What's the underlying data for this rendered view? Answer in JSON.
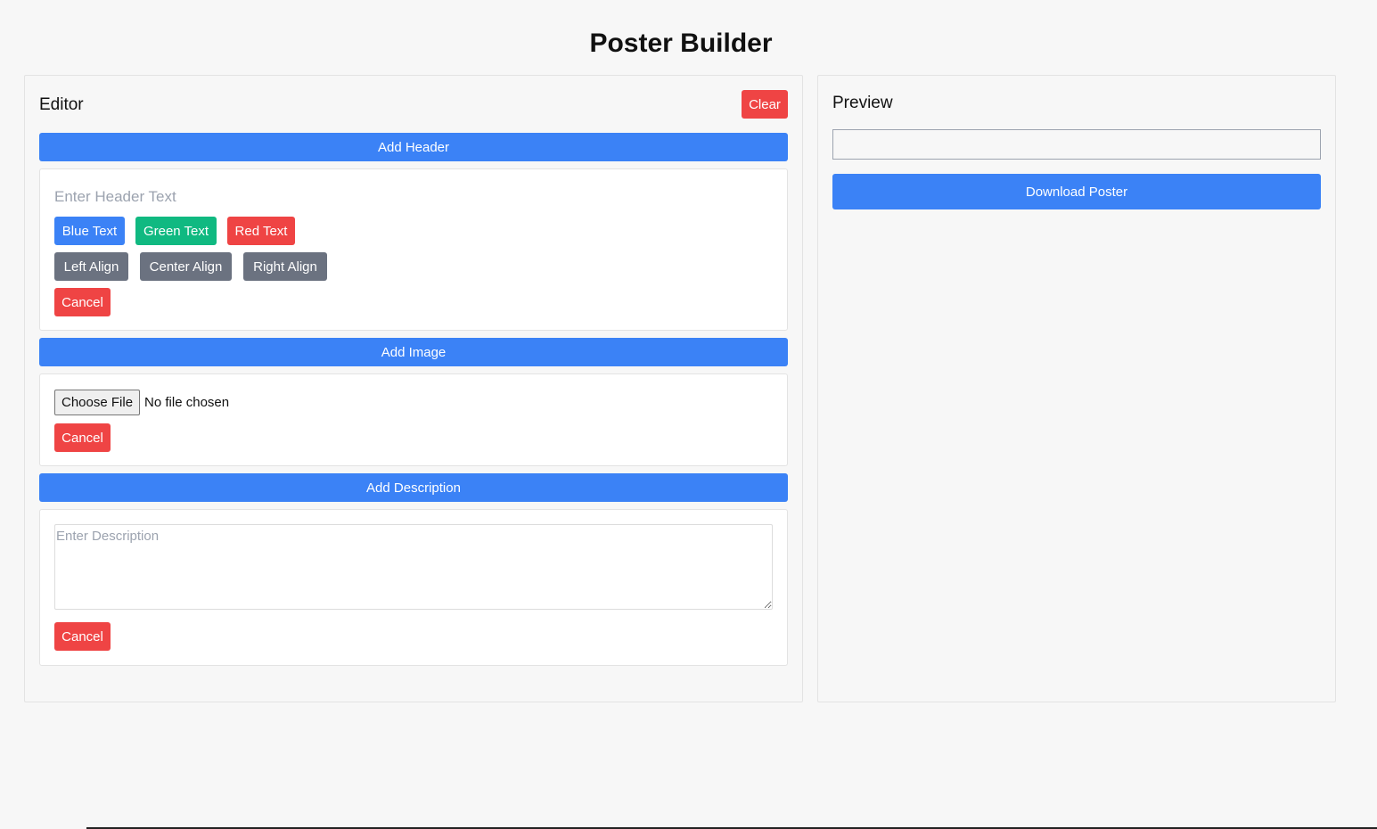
{
  "page": {
    "title": "Poster Builder"
  },
  "editor": {
    "title": "Editor",
    "clear_label": "Clear",
    "header_section": {
      "add_label": "Add Header",
      "input_placeholder": "Enter Header Text",
      "input_value": "",
      "color_buttons": [
        "Blue Text",
        "Green Text",
        "Red Text"
      ],
      "align_buttons": [
        "Left Align",
        "Center Align",
        "Right Align"
      ],
      "cancel_label": "Cancel"
    },
    "image_section": {
      "add_label": "Add Image",
      "choose_file_label": "Choose File",
      "file_status": "No file chosen",
      "cancel_label": "Cancel"
    },
    "description_section": {
      "add_label": "Add Description",
      "textarea_placeholder": "Enter Description",
      "cancel_label": "Cancel"
    }
  },
  "preview": {
    "title": "Preview",
    "download_label": "Download Poster"
  },
  "colors": {
    "blue": "#3b82f6",
    "green": "#10b981",
    "red": "#ef4444",
    "gray": "#6b7280",
    "background": "#f7f7f7"
  }
}
